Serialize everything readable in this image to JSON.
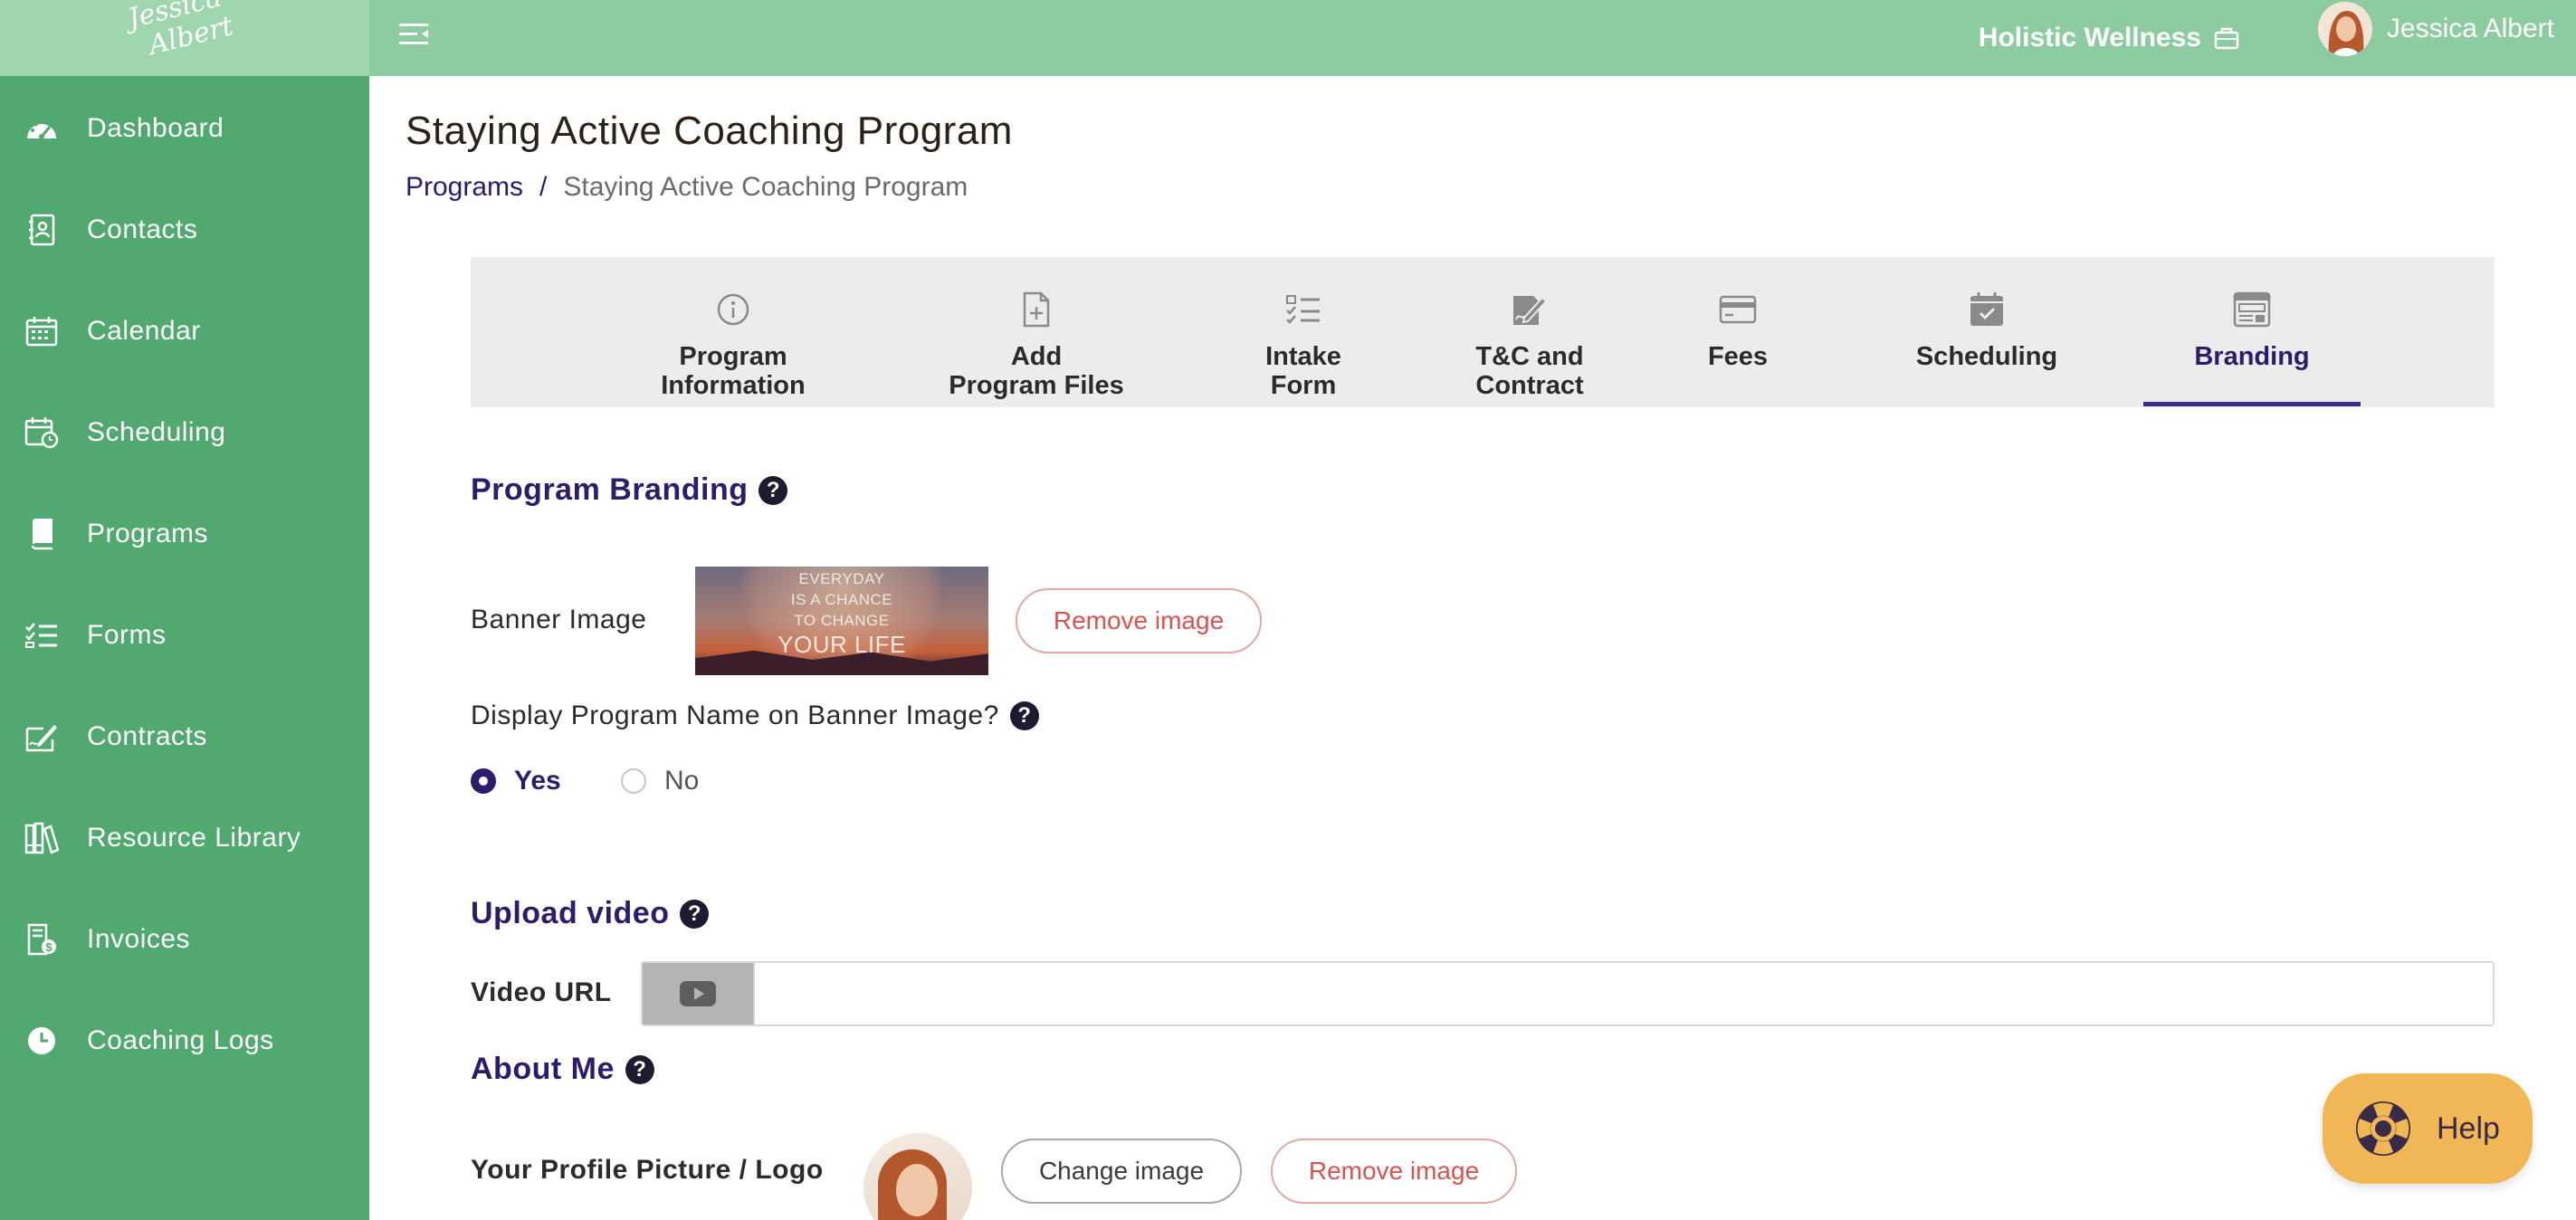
{
  "header": {
    "logo_line1": "Jessica",
    "logo_line2": "Albert",
    "brand_name": "Holistic Wellness",
    "user_name": "Jessica Albert"
  },
  "sidebar": {
    "items": [
      {
        "label": "Dashboard",
        "icon": "dashboard-gauge-icon"
      },
      {
        "label": "Contacts",
        "icon": "contacts-book-icon"
      },
      {
        "label": "Calendar",
        "icon": "calendar-icon"
      },
      {
        "label": "Scheduling",
        "icon": "scheduling-clock-calendar-icon"
      },
      {
        "label": "Programs",
        "icon": "book-icon"
      },
      {
        "label": "Forms",
        "icon": "checklist-icon"
      },
      {
        "label": "Contracts",
        "icon": "signature-pen-icon"
      },
      {
        "label": "Resource Library",
        "icon": "books-library-icon"
      },
      {
        "label": "Invoices",
        "icon": "invoice-dollar-icon"
      },
      {
        "label": "Coaching Logs",
        "icon": "clock-icon"
      }
    ]
  },
  "page": {
    "title": "Staying Active Coaching Program",
    "breadcrumb": {
      "root": "Programs",
      "separator": "/",
      "current": "Staying Active Coaching Program"
    }
  },
  "tabs": [
    {
      "label": "Program\nInformation",
      "icon": "info-circle-icon",
      "active": false
    },
    {
      "label": "Add\nProgram Files",
      "icon": "file-plus-icon",
      "active": false
    },
    {
      "label": "Intake\nForm",
      "icon": "checklist-icon",
      "active": false
    },
    {
      "label": "T&C and\nContract",
      "icon": "signature-pen-icon",
      "active": false
    },
    {
      "label": "Fees",
      "icon": "credit-card-icon",
      "active": false
    },
    {
      "label": "Scheduling",
      "icon": "calendar-check-icon",
      "active": false
    },
    {
      "label": "Branding",
      "icon": "browser-window-icon",
      "active": true
    }
  ],
  "branding": {
    "section_title": "Program Branding",
    "banner_label": "Banner Image",
    "banner_text": {
      "line1": "EVERYDAY",
      "line2": "IS A CHANCE",
      "line3": "TO CHANGE",
      "line4": "YOUR LIFE"
    },
    "remove_image_label": "Remove image",
    "display_question": "Display Program Name on Banner Image?",
    "radio_yes": "Yes",
    "radio_no": "No",
    "selected": "Yes"
  },
  "video": {
    "section_title": "Upload video",
    "field_label": "Video URL",
    "value": "",
    "placeholder": ""
  },
  "about": {
    "section_title": "About Me",
    "profile_label": "Your Profile Picture / Logo",
    "change_image_label": "Change image",
    "remove_image_label": "Remove image"
  },
  "help_button": {
    "label": "Help"
  },
  "colors": {
    "topbar": "#8ccca0",
    "sidebar": "#52a970",
    "accent": "#2c1c6b",
    "danger": "#d9534f",
    "help": "#f2b755"
  }
}
